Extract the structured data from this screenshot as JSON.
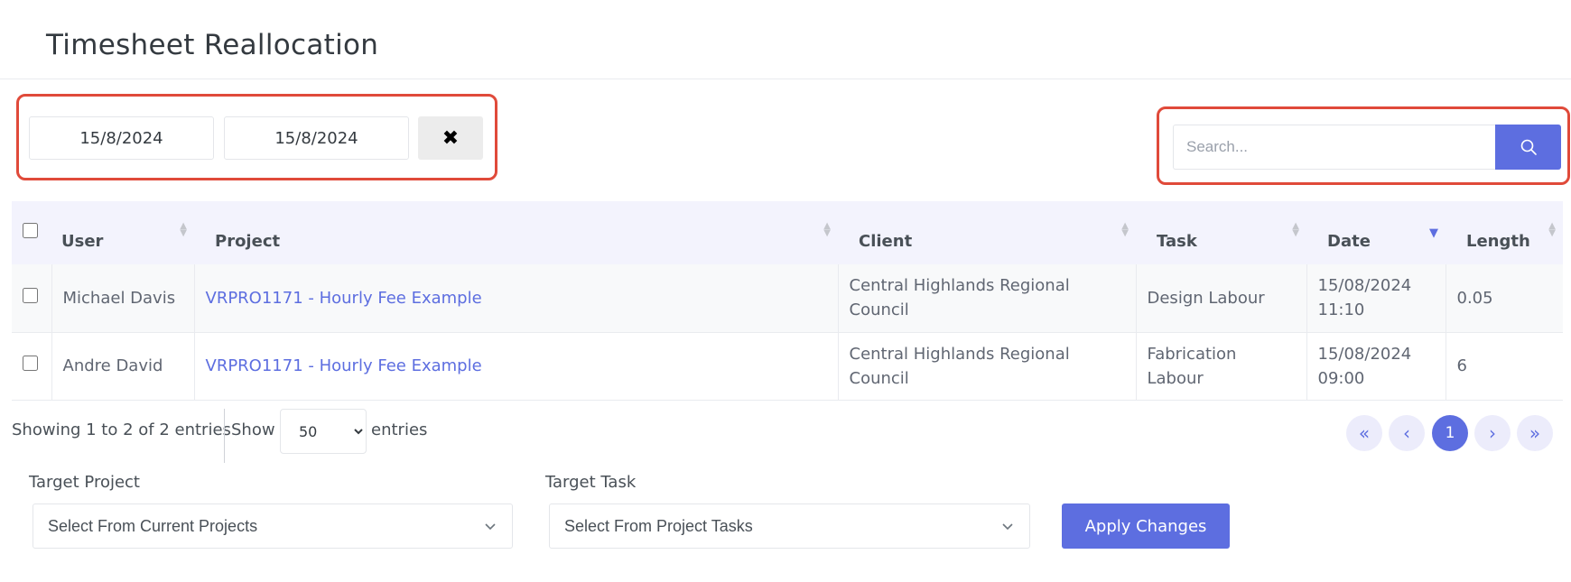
{
  "page": {
    "title": "Timesheet Reallocation"
  },
  "filters": {
    "date_from": "15/8/2024",
    "date_to": "15/8/2024",
    "clear_label": "✖"
  },
  "search": {
    "placeholder": "Search...",
    "icon": "search-icon"
  },
  "table": {
    "columns": [
      "User",
      "Project",
      "Client",
      "Task",
      "Date",
      "Length"
    ],
    "sorted_column": "Date",
    "sort_direction": "descending",
    "rows": [
      {
        "user": "Michael Davis",
        "project": "VRPRO1171 - Hourly Fee Example",
        "client_line1": "Central Highlands Regional",
        "client_line2": "Council",
        "task_line1": "Design Labour",
        "task_line2": "",
        "date_line1": "15/08/2024",
        "date_line2": "11:10",
        "length": "0.05"
      },
      {
        "user": "Andre David",
        "project": "VRPRO1171 - Hourly Fee Example",
        "client_line1": "Central Highlands Regional",
        "client_line2": "Council",
        "task_line1": "Fabrication",
        "task_line2": "Labour",
        "date_line1": "15/08/2024",
        "date_line2": "09:00",
        "length": "6"
      }
    ]
  },
  "footer": {
    "info": "Showing 1 to 2 of 2 entries",
    "show_label": "Show",
    "entries_value": "50",
    "entries_label": "entries"
  },
  "pagination": {
    "first": "«",
    "prev": "‹",
    "current": "1",
    "next": "›",
    "last": "»"
  },
  "reallocate": {
    "target_project_label": "Target Project",
    "target_project_placeholder": "Select From Current Projects",
    "target_task_label": "Target Task",
    "target_task_placeholder": "Select From Project Tasks",
    "apply_label": "Apply Changes"
  },
  "colors": {
    "accent": "#5d6ee0",
    "highlight": "#e04a3a"
  }
}
